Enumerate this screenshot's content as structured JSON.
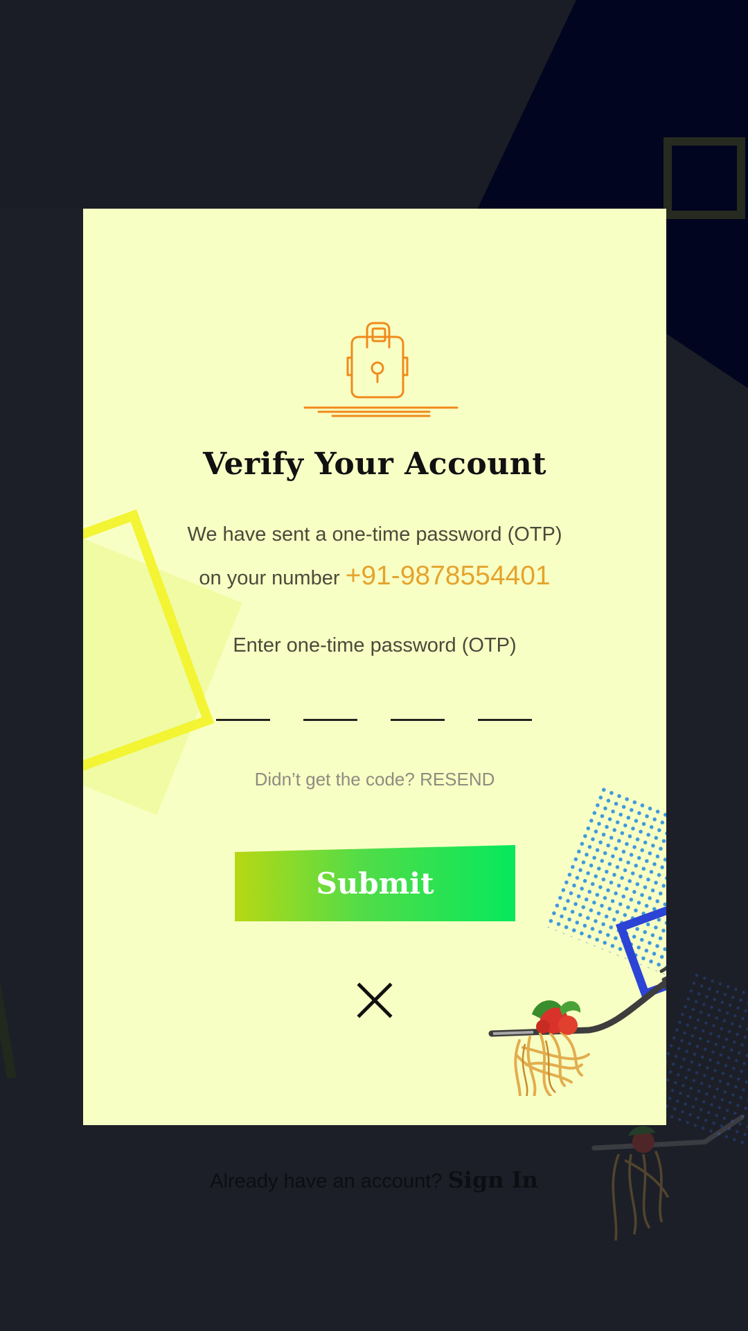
{
  "modal": {
    "title": "Verify Your Account",
    "message_line1": "We have sent a one-time password (OTP)",
    "message_line2_prefix": "on your number ",
    "phone_number": "+91-9878554401",
    "otp_label": "Enter one-time password (OTP)",
    "otp_digits": [
      "",
      "",
      "",
      ""
    ],
    "resend_prompt": "Didn’t get the code? ",
    "resend_link": "RESEND",
    "submit_label": "Submit"
  },
  "footer": {
    "prompt": "Already have an account? ",
    "signin_label": "Sign In"
  },
  "icons": {
    "lock": "lock-icon",
    "close": "close-icon"
  },
  "colors": {
    "background": "#1a1d25",
    "modal_background": "#f8ffc4",
    "phone_accent": "#e5a32d",
    "lock_stroke": "#f08a1c",
    "submit_gradient_start": "#b7d813",
    "submit_gradient_end": "#06e85c"
  }
}
